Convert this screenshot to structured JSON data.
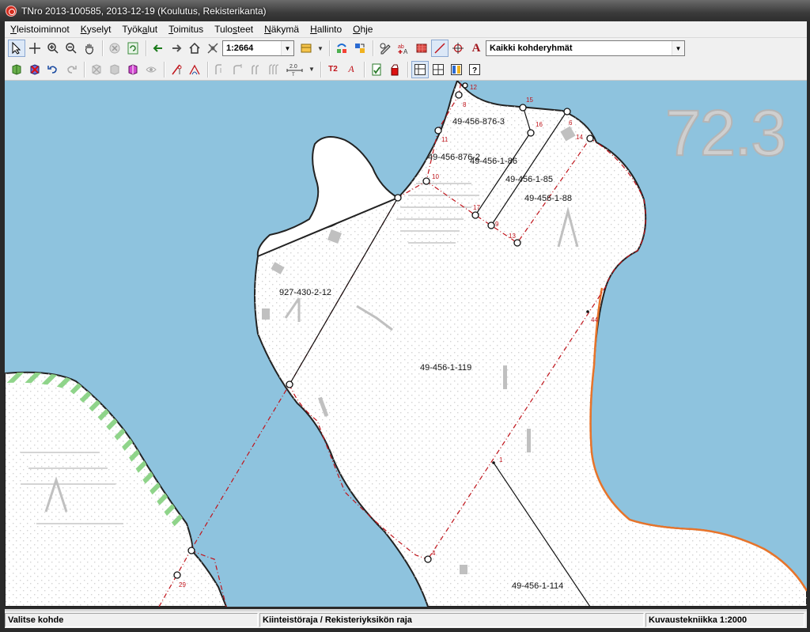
{
  "window": {
    "title": "TNro 2013-100585, 2013-12-19 (Koulutus, Rekisterikanta)"
  },
  "menu": [
    {
      "pre": "",
      "key": "Y",
      "post": "leistoiminnot"
    },
    {
      "pre": "",
      "key": "K",
      "post": "yselyt"
    },
    {
      "pre": "Työk",
      "key": "a",
      "post": "lut"
    },
    {
      "pre": "",
      "key": "T",
      "post": "oimitus"
    },
    {
      "pre": "Tulo",
      "key": "s",
      "post": "teet"
    },
    {
      "pre": "",
      "key": "N",
      "post": "äkymä"
    },
    {
      "pre": "",
      "key": "H",
      "post": "allinto"
    },
    {
      "pre": "",
      "key": "O",
      "post": "hje"
    }
  ],
  "toolbar": {
    "scale_value": "1:2664",
    "layer_filter_value": "Kaikki kohderyhmät",
    "text_tool_label": "T2",
    "text_tool2_label": "A",
    "dim_tool_label": "2.0"
  },
  "map": {
    "sheet_number": "72.3",
    "parcels": [
      {
        "id": "49-456-876-3"
      },
      {
        "id": "49-456-876-2"
      },
      {
        "id": "49-456-1-86"
      },
      {
        "id": "49-456-1-85"
      },
      {
        "id": "49-456-1-88"
      },
      {
        "id": "927-430-2-12"
      },
      {
        "id": "49-456-1-119"
      },
      {
        "id": "49-456-1-114"
      }
    ],
    "points": [
      "12",
      "8",
      "15",
      "16",
      "6",
      "14",
      "11",
      "10",
      "17",
      "9",
      "13",
      "44",
      "1",
      "4",
      "29"
    ]
  },
  "status": {
    "left": "Valitse kohde",
    "middle": "Kiinteistöraja / Rekisteriyksikön raja",
    "right": "Kuvaustekniikka 1:2000"
  },
  "colors": {
    "water": "#8ec3de",
    "land": "#ffffff",
    "boundary_red": "#c0141b",
    "shore_orange": "#e8742a",
    "green_hatch": "#8fd48a"
  }
}
